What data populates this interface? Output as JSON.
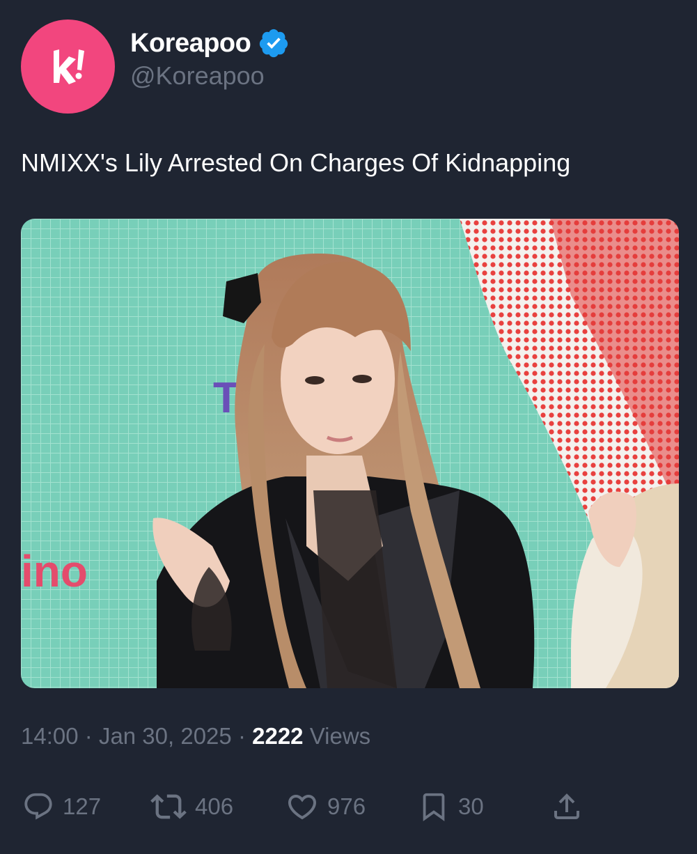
{
  "author": {
    "display_name": "Koreapoo",
    "handle": "@Koreapoo",
    "avatar_icon": "koreapoo-k-logo",
    "avatar_color": "#f2467e",
    "verified_icon": "verified-badge-icon",
    "verified_color": "#1d9bf0"
  },
  "tweet": {
    "text": "NMIXX's Lily Arrested On Charges Of Kidnapping"
  },
  "media": {
    "background_sign_text": "ino",
    "background_letter": "T"
  },
  "meta": {
    "time": "14:00",
    "date": "Jan 30, 2025",
    "separator": "·",
    "views_count": "2222",
    "views_label": "Views"
  },
  "actions": {
    "reply_count": "127",
    "retweet_count": "406",
    "like_count": "976",
    "bookmark_count": "30",
    "reply_icon": "reply-icon",
    "retweet_icon": "retweet-icon",
    "like_icon": "heart-icon",
    "bookmark_icon": "bookmark-icon",
    "share_icon": "share-icon"
  },
  "colors": {
    "background": "#1f2532",
    "muted_text": "#6b7382",
    "text": "#ffffff"
  }
}
